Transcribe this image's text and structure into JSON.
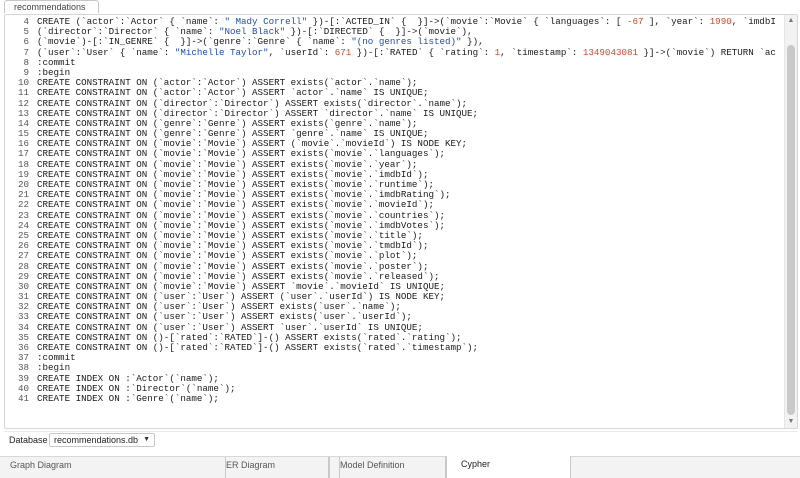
{
  "top_tab": {
    "label": "recommendations"
  },
  "editor": {
    "lines": [
      {
        "n": "4",
        "segs": [
          [
            "txt",
            "CREATE (`actor`:`Actor` { `name`: "
          ],
          [
            "str",
            "\" Mady Correll\""
          ],
          [
            "txt",
            " })-[:`ACTED_IN` {  }]->(`movie`:`Movie` { `languages`: [ "
          ],
          [
            "num",
            "-67"
          ],
          [
            "txt",
            " ], `year`: "
          ],
          [
            "num",
            "1990"
          ],
          [
            "txt",
            ", `imdbI"
          ]
        ]
      },
      {
        "n": "5",
        "segs": [
          [
            "txt",
            "(`director`:`Director` { `name`: "
          ],
          [
            "str",
            "\"Noel Black\""
          ],
          [
            "txt",
            " })-[:`DIRECTED` {  }]->(`movie`),"
          ]
        ]
      },
      {
        "n": "6",
        "segs": [
          [
            "txt",
            "(`movie`)-[:`IN_GENRE` {  }]->(`genre`:`Genre` { `name`: "
          ],
          [
            "str",
            "\"(no genres listed)\""
          ],
          [
            "txt",
            " }),"
          ]
        ]
      },
      {
        "n": "7",
        "segs": [
          [
            "txt",
            "(`user`:`User` { `name`: "
          ],
          [
            "str",
            "\"Michelle Taylor\""
          ],
          [
            "txt",
            ", `userId`: "
          ],
          [
            "num",
            "671"
          ],
          [
            "txt",
            " })-[:`RATED` { `rating`: "
          ],
          [
            "num",
            "1"
          ],
          [
            "txt",
            ", `timestamp`: "
          ],
          [
            "num",
            "1349043081"
          ],
          [
            "txt",
            " }]->(`movie`) RETURN `ac"
          ]
        ]
      },
      {
        "n": "8",
        "segs": [
          [
            "txt",
            ":commit"
          ]
        ]
      },
      {
        "n": "9",
        "segs": [
          [
            "txt",
            ":begin"
          ]
        ]
      },
      {
        "n": "10",
        "segs": [
          [
            "txt",
            "CREATE CONSTRAINT ON (`actor`:`Actor`) ASSERT exists(`actor`.`name`);"
          ]
        ]
      },
      {
        "n": "11",
        "segs": [
          [
            "txt",
            "CREATE CONSTRAINT ON (`actor`:`Actor`) ASSERT `actor`.`name` IS UNIQUE;"
          ]
        ]
      },
      {
        "n": "12",
        "segs": [
          [
            "txt",
            "CREATE CONSTRAINT ON (`director`:`Director`) ASSERT exists(`director`.`name`);"
          ]
        ]
      },
      {
        "n": "13",
        "segs": [
          [
            "txt",
            "CREATE CONSTRAINT ON (`director`:`Director`) ASSERT `director`.`name` IS UNIQUE;"
          ]
        ]
      },
      {
        "n": "14",
        "segs": [
          [
            "txt",
            "CREATE CONSTRAINT ON (`genre`:`Genre`) ASSERT exists(`genre`.`name`);"
          ]
        ]
      },
      {
        "n": "15",
        "segs": [
          [
            "txt",
            "CREATE CONSTRAINT ON (`genre`:`Genre`) ASSERT `genre`.`name` IS UNIQUE;"
          ]
        ]
      },
      {
        "n": "16",
        "segs": [
          [
            "txt",
            "CREATE CONSTRAINT ON (`movie`:`Movie`) ASSERT (`movie`.`movieId`) IS NODE KEY;"
          ]
        ]
      },
      {
        "n": "17",
        "segs": [
          [
            "txt",
            "CREATE CONSTRAINT ON (`movie`:`Movie`) ASSERT exists(`movie`.`languages`);"
          ]
        ]
      },
      {
        "n": "18",
        "segs": [
          [
            "txt",
            "CREATE CONSTRAINT ON (`movie`:`Movie`) ASSERT exists(`movie`.`year`);"
          ]
        ]
      },
      {
        "n": "19",
        "segs": [
          [
            "txt",
            "CREATE CONSTRAINT ON (`movie`:`Movie`) ASSERT exists(`movie`.`imdbId`);"
          ]
        ]
      },
      {
        "n": "20",
        "segs": [
          [
            "txt",
            "CREATE CONSTRAINT ON (`movie`:`Movie`) ASSERT exists(`movie`.`runtime`);"
          ]
        ]
      },
      {
        "n": "21",
        "segs": [
          [
            "txt",
            "CREATE CONSTRAINT ON (`movie`:`Movie`) ASSERT exists(`movie`.`imdbRating`);"
          ]
        ]
      },
      {
        "n": "22",
        "segs": [
          [
            "txt",
            "CREATE CONSTRAINT ON (`movie`:`Movie`) ASSERT exists(`movie`.`movieId`);"
          ]
        ]
      },
      {
        "n": "23",
        "segs": [
          [
            "txt",
            "CREATE CONSTRAINT ON (`movie`:`Movie`) ASSERT exists(`movie`.`countries`);"
          ]
        ]
      },
      {
        "n": "24",
        "segs": [
          [
            "txt",
            "CREATE CONSTRAINT ON (`movie`:`Movie`) ASSERT exists(`movie`.`imdbVotes`);"
          ]
        ]
      },
      {
        "n": "25",
        "segs": [
          [
            "txt",
            "CREATE CONSTRAINT ON (`movie`:`Movie`) ASSERT exists(`movie`.`title`);"
          ]
        ]
      },
      {
        "n": "26",
        "segs": [
          [
            "txt",
            "CREATE CONSTRAINT ON (`movie`:`Movie`) ASSERT exists(`movie`.`tmdbId`);"
          ]
        ]
      },
      {
        "n": "27",
        "segs": [
          [
            "txt",
            "CREATE CONSTRAINT ON (`movie`:`Movie`) ASSERT exists(`movie`.`plot`);"
          ]
        ]
      },
      {
        "n": "28",
        "segs": [
          [
            "txt",
            "CREATE CONSTRAINT ON (`movie`:`Movie`) ASSERT exists(`movie`.`poster`);"
          ]
        ]
      },
      {
        "n": "29",
        "segs": [
          [
            "txt",
            "CREATE CONSTRAINT ON (`movie`:`Movie`) ASSERT exists(`movie`.`released`);"
          ]
        ]
      },
      {
        "n": "30",
        "segs": [
          [
            "txt",
            "CREATE CONSTRAINT ON (`movie`:`Movie`) ASSERT `movie`.`movieId` IS UNIQUE;"
          ]
        ]
      },
      {
        "n": "31",
        "segs": [
          [
            "txt",
            "CREATE CONSTRAINT ON (`user`:`User`) ASSERT (`user`.`userId`) IS NODE KEY;"
          ]
        ]
      },
      {
        "n": "32",
        "segs": [
          [
            "txt",
            "CREATE CONSTRAINT ON (`user`:`User`) ASSERT exists(`user`.`name`);"
          ]
        ]
      },
      {
        "n": "33",
        "segs": [
          [
            "txt",
            "CREATE CONSTRAINT ON (`user`:`User`) ASSERT exists(`user`.`userId`);"
          ]
        ]
      },
      {
        "n": "34",
        "segs": [
          [
            "txt",
            "CREATE CONSTRAINT ON (`user`:`User`) ASSERT `user`.`userId` IS UNIQUE;"
          ]
        ]
      },
      {
        "n": "35",
        "segs": [
          [
            "txt",
            "CREATE CONSTRAINT ON ()-[`rated`:`RATED`]-() ASSERT exists(`rated`.`rating`);"
          ]
        ]
      },
      {
        "n": "36",
        "segs": [
          [
            "txt",
            "CREATE CONSTRAINT ON ()-[`rated`:`RATED`]-() ASSERT exists(`rated`.`timestamp`);"
          ]
        ]
      },
      {
        "n": "37",
        "segs": [
          [
            "txt",
            ":commit"
          ]
        ]
      },
      {
        "n": "38",
        "segs": [
          [
            "txt",
            ":begin"
          ]
        ]
      },
      {
        "n": "39",
        "segs": [
          [
            "txt",
            "CREATE INDEX ON :`Actor`(`name`);"
          ]
        ]
      },
      {
        "n": "40",
        "segs": [
          [
            "txt",
            "CREATE INDEX ON :`Director`(`name`);"
          ]
        ]
      },
      {
        "n": "41",
        "segs": [
          [
            "txt",
            "CREATE INDEX ON :`Genre`(`name`);"
          ]
        ]
      }
    ],
    "colors": {
      "string": "#1f4fb5",
      "number": "#d04a2a",
      "text": "#1a1a1a"
    }
  },
  "database_bar": {
    "label": "Database",
    "selected": "recommendations.db",
    "caret_icon": "chevron-down-icon"
  },
  "bottom_tabs": [
    {
      "label": "Graph Diagram",
      "active": false
    },
    {
      "label": "ER Diagram",
      "active": false
    },
    {
      "label": "Model Definition",
      "active": false
    },
    {
      "label": "Cypher",
      "active": true
    }
  ]
}
